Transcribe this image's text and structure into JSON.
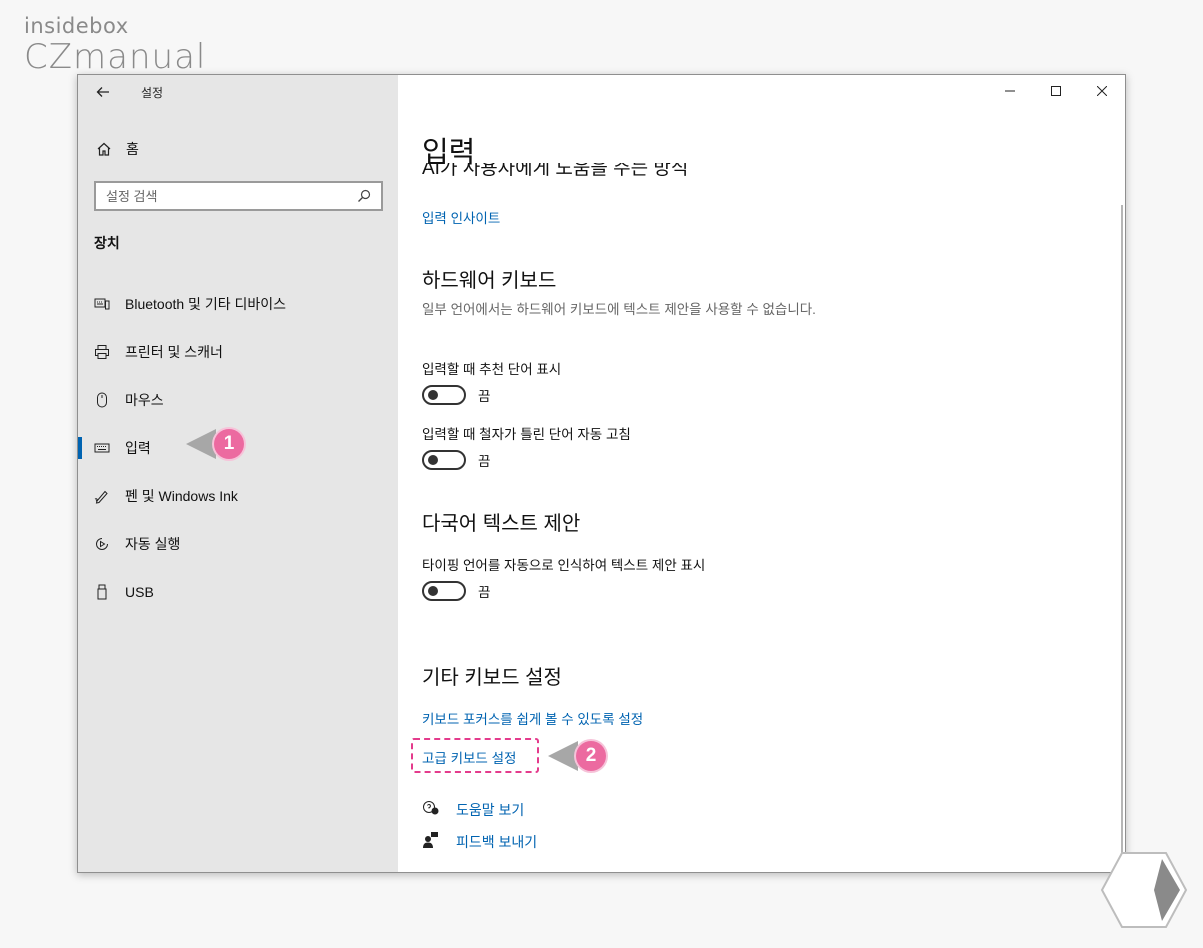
{
  "logo": {
    "line1": "insidebox",
    "line2": "CZmanual"
  },
  "window": {
    "title": "설정",
    "controls": {
      "minimize": "—",
      "maximize": "☐",
      "close": "✕"
    }
  },
  "sidebar": {
    "home_label": "홈",
    "search_placeholder": "설정 검색",
    "section_title": "장치",
    "items": [
      {
        "label": "Bluetooth 및 기타 디바이스",
        "icon": "keyboard-phone-icon"
      },
      {
        "label": "프린터 및 스캐너",
        "icon": "printer-icon"
      },
      {
        "label": "마우스",
        "icon": "mouse-icon"
      },
      {
        "label": "입력",
        "icon": "keyboard-icon",
        "active": true
      },
      {
        "label": "펜 및 Windows Ink",
        "icon": "pen-icon"
      },
      {
        "label": "자동 실행",
        "icon": "autoplay-icon"
      },
      {
        "label": "USB",
        "icon": "usb-icon"
      }
    ]
  },
  "content": {
    "heading": "입력",
    "clipped_heading": "AI가 사용자에게 도움을 주는 방식",
    "typing_insights_link": "입력 인사이트",
    "hardware_keyboard": {
      "title": "하드웨어 키보드",
      "description": "일부 언어에서는 하드웨어 키보드에 텍스트 제안을 사용할 수 없습니다.",
      "option1_label": "입력할 때 추천 단어 표시",
      "option1_state": "끔",
      "option2_label": "입력할 때 철자가 틀린 단어 자동 고침",
      "option2_state": "끔"
    },
    "multilingual": {
      "title": "다국어 텍스트 제안",
      "option_label": "타이핑 언어를 자동으로 인식하여 텍스트 제안 표시",
      "option_state": "끔"
    },
    "other_keyboard": {
      "title": "기타 키보드 설정",
      "focus_link": "키보드 포커스를 쉽게 볼 수 있도록 설정",
      "advanced_link": "고급 키보드 설정"
    },
    "help_link": "도움말 보기",
    "feedback_link": "피드백 보내기"
  },
  "callouts": {
    "first": "1",
    "second": "2"
  },
  "colors": {
    "accent": "#0063b1",
    "callout": "#ec6aa0",
    "sidebar_bg": "#e6e6e6"
  }
}
